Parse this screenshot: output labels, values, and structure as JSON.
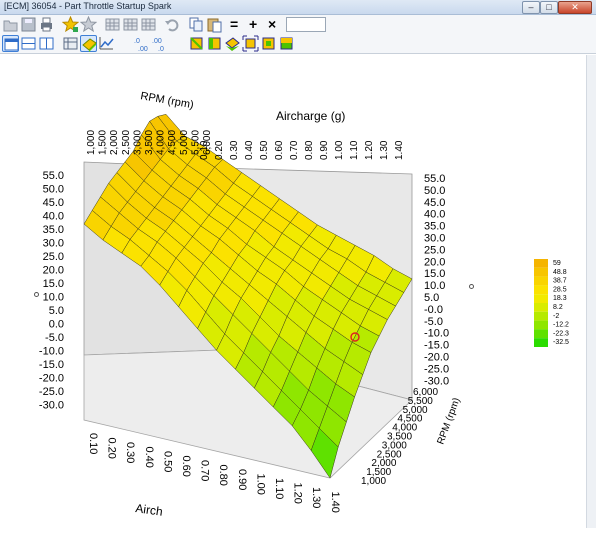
{
  "window": {
    "title": "[ECM] 36054 - Part Throttle Startup Spark",
    "buttons": {
      "minimize": "–",
      "maximize": "□",
      "close": "✕"
    }
  },
  "toolbar": {
    "equals_label": "=",
    "plus_label": "+",
    "times_label": "×",
    "value_input": ""
  },
  "chart": {
    "x_axis_title": "Aircharge (g)",
    "y_axis_title": "RPM (rpm)",
    "y_axis_title_side": "RPM (rpm)",
    "x_axis_title_bottom": "Airch",
    "airchage_ticks": [
      "0.10",
      "0.20",
      "0.30",
      "0.40",
      "0.50",
      "0.60",
      "0.70",
      "0.80",
      "0.90",
      "1.00",
      "1.10",
      "1.20",
      "1.30",
      "1.40"
    ],
    "rpm_ticks": [
      "1,000",
      "1,500",
      "2,000",
      "2,500",
      "3,000",
      "3,500",
      "4,000",
      "4,500",
      "5,000",
      "5,500",
      "6,000"
    ],
    "z_ticks": [
      "55.0",
      "50.0",
      "45.0",
      "40.0",
      "35.0",
      "30.0",
      "25.0",
      "20.0",
      "15.0",
      "10.0",
      "5.0",
      "0.0",
      "-5.0",
      "-10.0",
      "-15.0",
      "-20.0",
      "-25.0",
      "-30.0"
    ],
    "z_ticks_right": [
      "55.0",
      "50.0",
      "45.0",
      "40.0",
      "35.0",
      "30.0",
      "25.0",
      "20.0",
      "15.0",
      "10.0",
      "5.0",
      "-0.0",
      "-5.0",
      "-10.0",
      "-15.0",
      "-20.0",
      "-25.0",
      "-30.0"
    ]
  },
  "legend": {
    "values": [
      "59",
      "48.8",
      "38.7",
      "28.5",
      "18.3",
      "8.2",
      "-2",
      "-12.2",
      "-22.3",
      "-32.5"
    ],
    "colors": [
      "#f5b400",
      "#f7c500",
      "#f9d400",
      "#fbe200",
      "#f2ea00",
      "#d9ec00",
      "#b6ea00",
      "#8fe600",
      "#5fe100",
      "#2bdc00"
    ]
  },
  "chart_data": {
    "type": "surface",
    "title": "",
    "xlabel": "Aircharge (g)",
    "ylabel": "RPM (rpm)",
    "zlabel": "",
    "x": [
      0.1,
      0.2,
      0.3,
      0.4,
      0.5,
      0.6,
      0.7,
      0.8,
      0.9,
      1.0,
      1.1,
      1.2,
      1.3,
      1.4
    ],
    "y": [
      1000,
      1500,
      2000,
      2500,
      3000,
      3500,
      4000,
      4500,
      5000,
      5500,
      6000
    ],
    "xlim": [
      0.1,
      1.4
    ],
    "ylim": [
      1000,
      6000
    ],
    "zlim": [
      -30,
      55
    ],
    "z_approx": [
      [
        38,
        34,
        31,
        28,
        23,
        17,
        11,
        5,
        0,
        -5,
        -10,
        -15,
        -22,
        -30
      ],
      [
        40,
        36,
        33,
        29,
        25,
        20,
        14,
        8,
        3,
        -2,
        -7,
        -12,
        -17,
        -22
      ],
      [
        42,
        38,
        34,
        31,
        27,
        22,
        17,
        12,
        7,
        2,
        -3,
        -8,
        -12,
        -16
      ],
      [
        44,
        39,
        35,
        32,
        28,
        24,
        19,
        15,
        10,
        5,
        1,
        -3,
        -7,
        -10
      ],
      [
        45,
        40,
        36,
        33,
        29,
        25,
        21,
        17,
        13,
        9,
        5,
        1,
        -2,
        -5
      ],
      [
        46,
        41,
        37,
        34,
        30,
        27,
        23,
        19,
        16,
        12,
        8,
        5,
        2,
        0
      ],
      [
        47,
        42,
        38,
        35,
        31,
        28,
        24,
        21,
        18,
        14,
        11,
        8,
        5,
        3
      ],
      [
        50,
        43,
        39,
        36,
        32,
        29,
        26,
        22,
        19,
        16,
        13,
        10,
        8,
        6
      ],
      [
        52,
        44,
        40,
        37,
        33,
        30,
        27,
        24,
        21,
        18,
        15,
        12,
        10,
        8
      ],
      [
        51,
        44,
        41,
        38,
        34,
        31,
        28,
        25,
        22,
        19,
        17,
        14,
        12,
        10
      ],
      [
        49,
        43,
        41,
        38,
        35,
        32,
        29,
        26,
        23,
        21,
        19,
        17,
        14,
        12
      ]
    ]
  }
}
